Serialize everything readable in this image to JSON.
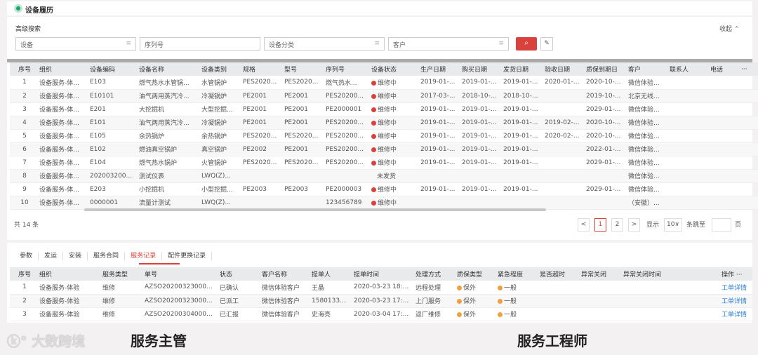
{
  "page": {
    "title": "设备履历",
    "advanced_search": "高级搜索",
    "collapse": "收起"
  },
  "filters": [
    {
      "placeholder": "设备"
    },
    {
      "placeholder": "序列号"
    },
    {
      "placeholder": "设备分类"
    },
    {
      "placeholder": "客户"
    }
  ],
  "icons": {
    "search": "search-icon",
    "eraser": "eraser-icon",
    "list": "list-icon"
  },
  "colors": {
    "accent": "#d9423c",
    "status_red": "#d9423c",
    "orange": "#f0a040",
    "link": "#2b7fd6",
    "brand": "#1aa26b"
  },
  "equipment": {
    "columns": [
      "序号",
      "组织",
      "设备编码",
      "设备名称",
      "设备类别",
      "规格",
      "型号",
      "序列号",
      "设备状态",
      "生产日期",
      "购买日期",
      "发货日期",
      "验收日期",
      "质保到期日",
      "客户",
      "联系人",
      "电话",
      "···"
    ],
    "rows": [
      [
        "1",
        "设备服务-体...",
        "E103",
        "燃气热水水管锅...",
        "水管锅炉",
        "PES2020...",
        "PES2020...",
        "燃气热水...",
        "维修中",
        "2019-01-...",
        "2019-01-...",
        "2019-01-...",
        "2020-01-...",
        "2020-10-...",
        "微信体验...",
        "",
        ""
      ],
      [
        "2",
        "设备服务-体...",
        "E10101",
        "油气两用蒸汽冷...",
        "冷凝锅炉",
        "PE2001",
        "PE2001",
        "PES20200...",
        "维修中",
        "2017-03-...",
        "2018-10-...",
        "2018-10-...",
        "",
        "2019-10-...",
        "北京无线...",
        "",
        ""
      ],
      [
        "3",
        "设备服务-体...",
        "E201",
        "大挖掘机",
        "大型挖掘...",
        "PE2001",
        "PE2001",
        "PE2000001",
        "维修中",
        "2019-01-...",
        "2019-01-...",
        "2019-01-...",
        "",
        "2029-01-...",
        "微信体验...",
        "",
        ""
      ],
      [
        "4",
        "设备服务-体...",
        "E101",
        "油气两用蒸汽冷...",
        "冷凝锅炉",
        "PE2001",
        "PE2001",
        "PES20200...",
        "维修中",
        "2019-01-...",
        "2019-01-...",
        "2019-01-...",
        "2019-02-...",
        "2020-10-...",
        "微信体验...",
        "",
        ""
      ],
      [
        "5",
        "设备服务-体...",
        "E105",
        "余热锅炉",
        "余热锅炉",
        "PES2020...",
        "PES2020...",
        "PES20200...",
        "维修中",
        "2019-01-...",
        "2019-01-...",
        "2019-01-...",
        "2020-02-...",
        "2020-10-...",
        "微信体验...",
        "",
        ""
      ],
      [
        "6",
        "设备服务-体...",
        "E102",
        "燃油真空锅炉",
        "真空锅炉",
        "PE2002",
        "PE2001",
        "PES20200...",
        "维修中",
        "2019-01-...",
        "2019-01-...",
        "2019-01-...",
        "",
        "2022-01-...",
        "微信体验...",
        "",
        ""
      ],
      [
        "7",
        "设备服务-体...",
        "E104",
        "燃气热水锅炉",
        "火管锅炉",
        "PES2020...",
        "PES2020...",
        "PES20200...",
        "维修中",
        "2019-01-...",
        "2019-01-...",
        "2019-01-...",
        "",
        "2029-01-...",
        "微信体验...",
        "",
        ""
      ],
      [
        "8",
        "设备服务-体...",
        "202003200...",
        "测试仪表",
        "LWQ(Z)...",
        "",
        "",
        "",
        "未发货",
        "",
        "",
        "",
        "",
        "",
        "微信体验...",
        "",
        ""
      ],
      [
        "9",
        "设备服务-体...",
        "E203",
        "小挖掘机",
        "小型挖掘...",
        "PE2003",
        "PE2003",
        "PE2000003",
        "维修中",
        "2019-01-...",
        "2019-01-...",
        "2019-01-...",
        "",
        "2029-01-...",
        "微信体验...",
        "",
        ""
      ],
      [
        "10",
        "设备服务-体...",
        "0000001",
        "流量计测试",
        "LWQ(Z)...",
        "",
        "",
        "123456789",
        "维修中",
        "",
        "",
        "",
        "",
        "",
        "（安徽）...",
        "",
        ""
      ]
    ]
  },
  "pagination": {
    "total": "共 14 条",
    "prev": "<",
    "pages": [
      "1",
      "2"
    ],
    "current": "1",
    "next": ">",
    "show": "显示",
    "page_size": "10∨",
    "jump": "条跳至",
    "page_unit": "页"
  },
  "tabs": {
    "items": [
      "参数",
      "发运",
      "安装",
      "服务合同",
      "服务记录",
      "配件更换记录"
    ],
    "active": "服务记录"
  },
  "service": {
    "columns": [
      "序号",
      "组织",
      "服务类型",
      "单号",
      "状态",
      "客户名称",
      "提单人",
      "提单时间",
      "处理方式",
      "质保类型",
      "紧急程度",
      "是否超时",
      "异常关闭",
      "异常关闭时间",
      "操作 ···"
    ],
    "rows": [
      [
        "1",
        "设备服务-体验",
        "维修",
        "AZSO20200323000...",
        "已确认",
        "微信体验客户",
        "王晶",
        "2020-03-23 18:...",
        "远程处理",
        "保外",
        "一般",
        "",
        "",
        "",
        "工单详情"
      ],
      [
        "2",
        "设备服务-体验",
        "维修",
        "AZSO20200323000...",
        "已派工",
        "微信体验客户",
        "1580133...",
        "2020-03-23 17:...",
        "上门服务",
        "保外",
        "一般",
        "",
        "",
        "",
        "工单详情"
      ],
      [
        "3",
        "设备服务-体验",
        "维修",
        "AZSO20200304000...",
        "已汇报",
        "微信体验客户",
        "史海亮",
        "2020-03-04 17:...",
        "返厂维修",
        "保外",
        "一般",
        "",
        "",
        "",
        "工单详情"
      ]
    ]
  },
  "captions": {
    "left": "服务主管",
    "right": "服务工程师",
    "watermark": "大数跨境"
  }
}
